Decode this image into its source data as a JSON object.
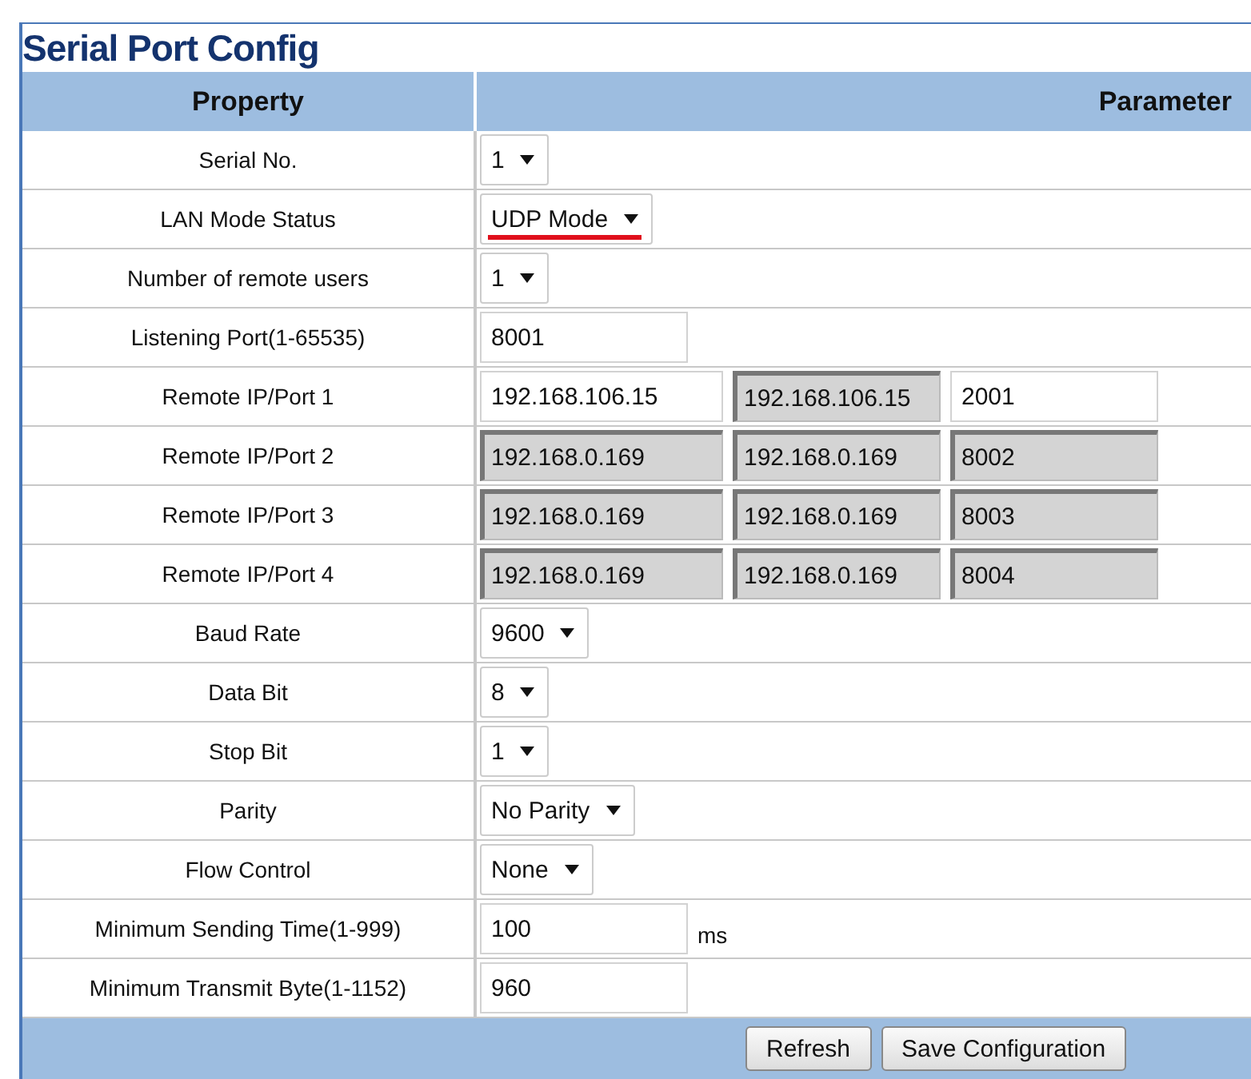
{
  "title": "Serial Port Config",
  "columns": [
    "Property",
    "Parameter"
  ],
  "rows": [
    {
      "label": "Serial No.",
      "kind": "select",
      "value": "1"
    },
    {
      "label": "LAN Mode Status",
      "kind": "select",
      "value": "UDP Mode",
      "underlined": true
    },
    {
      "label": "Number of remote users",
      "kind": "select",
      "value": "1"
    },
    {
      "label": "Listening Port(1-65535)",
      "kind": "text",
      "value": "8001"
    },
    {
      "label": "Remote IP/Port 1",
      "kind": "remote",
      "fields": [
        {
          "value": "192.168.106.15",
          "disabled": false
        },
        {
          "value": "192.168.106.15",
          "disabled": true
        },
        {
          "value": "2001",
          "disabled": false
        }
      ]
    },
    {
      "label": "Remote IP/Port 2",
      "kind": "remote",
      "fields": [
        {
          "value": "192.168.0.169",
          "disabled": true
        },
        {
          "value": "192.168.0.169",
          "disabled": true
        },
        {
          "value": "8002",
          "disabled": true
        }
      ]
    },
    {
      "label": "Remote IP/Port 3",
      "kind": "remote",
      "fields": [
        {
          "value": "192.168.0.169",
          "disabled": true
        },
        {
          "value": "192.168.0.169",
          "disabled": true
        },
        {
          "value": "8003",
          "disabled": true
        }
      ]
    },
    {
      "label": "Remote IP/Port 4",
      "kind": "remote",
      "fields": [
        {
          "value": "192.168.0.169",
          "disabled": true
        },
        {
          "value": "192.168.0.169",
          "disabled": true
        },
        {
          "value": "8004",
          "disabled": true
        }
      ]
    },
    {
      "label": "Baud Rate",
      "kind": "select",
      "value": "9600"
    },
    {
      "label": "Data Bit",
      "kind": "select",
      "value": "8"
    },
    {
      "label": "Stop Bit",
      "kind": "select",
      "value": "1"
    },
    {
      "label": "Parity",
      "kind": "select",
      "value": "No Parity"
    },
    {
      "label": "Flow Control",
      "kind": "select",
      "value": "None"
    },
    {
      "label": "Minimum Sending Time(1-999)",
      "kind": "text",
      "value": "100",
      "suffix": "ms"
    },
    {
      "label": "Minimum Transmit Byte(1-1152)",
      "kind": "text",
      "value": "960"
    }
  ],
  "buttons": [
    "Refresh",
    "Save Configuration"
  ]
}
